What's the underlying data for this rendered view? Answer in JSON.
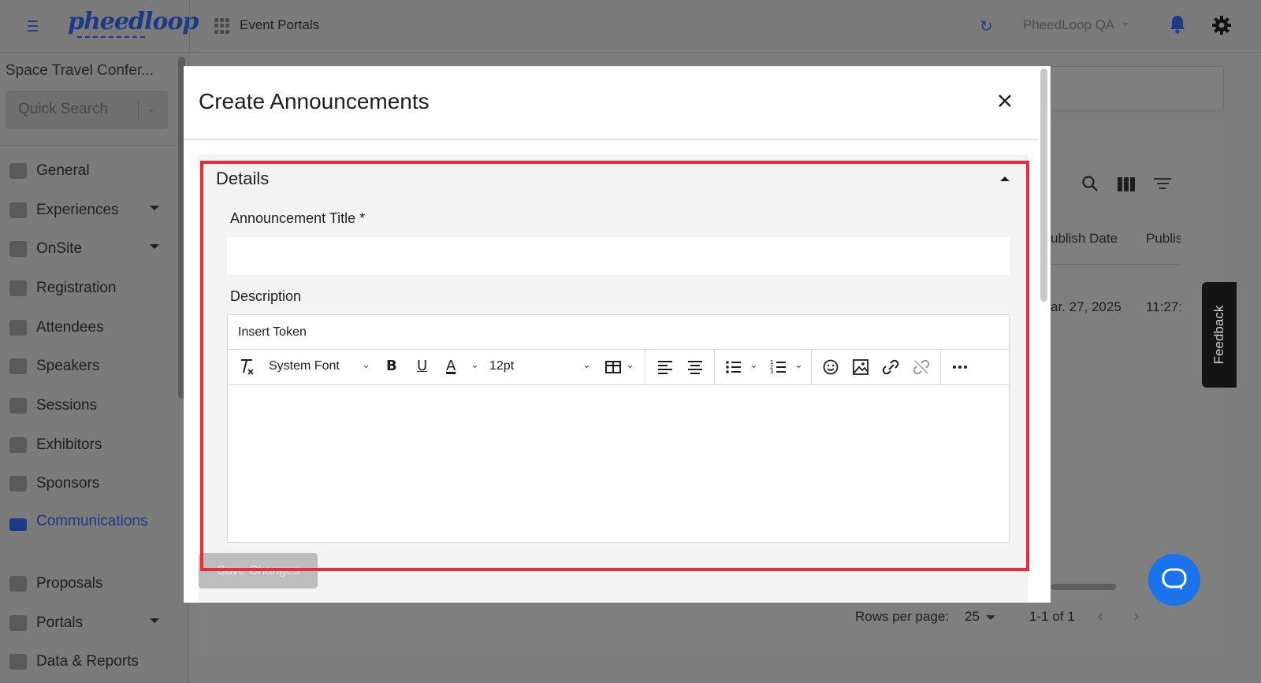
{
  "app": {
    "logo": "pheedloop",
    "section_title": "Event Portals",
    "organization": "PheedLoop QA"
  },
  "sidebar": {
    "event_name": "Space Travel Confer...",
    "quick_search_placeholder": "Quick Search",
    "items": [
      {
        "label": "General",
        "icon": "grid-icon",
        "expandable": false
      },
      {
        "label": "Experiences",
        "icon": "person-icon",
        "expandable": true
      },
      {
        "label": "OnSite",
        "icon": "printer-icon",
        "expandable": true
      },
      {
        "label": "Registration",
        "icon": "cart-icon",
        "expandable": false
      },
      {
        "label": "Attendees",
        "icon": "people-icon",
        "expandable": false
      },
      {
        "label": "Speakers",
        "icon": "speaker-icon",
        "expandable": false
      },
      {
        "label": "Sessions",
        "icon": "laptop-icon",
        "expandable": false
      },
      {
        "label": "Exhibitors",
        "icon": "store-icon",
        "expandable": false
      },
      {
        "label": "Sponsors",
        "icon": "badge-icon",
        "expandable": false
      },
      {
        "label": "Communications",
        "icon": "mail-icon",
        "expandable": false,
        "active": true
      },
      {
        "label": "Proposals",
        "icon": "document-icon",
        "expandable": false
      },
      {
        "label": "Portals",
        "icon": "globe-icon",
        "expandable": true
      },
      {
        "label": "Data & Reports",
        "icon": "chart-icon",
        "expandable": false
      }
    ]
  },
  "background_table": {
    "col_publish_date": "ublish Date",
    "col_publish_time": "Publis",
    "row_date": "ar. 27, 2025",
    "row_time": "11:27:3",
    "rows_per_page_label": "Rows per page:",
    "rows_per_page_value": "25",
    "range": "1-1 of 1"
  },
  "feedback_label": "Feedback",
  "modal": {
    "title": "Create Announcements",
    "section_title": "Details",
    "title_field_label": "Announcement Title *",
    "title_field_value": "",
    "description_label": "Description",
    "insert_token_label": "Insert Token",
    "font_family": "System Font",
    "font_size": "12pt",
    "save_label": "Save Changes"
  },
  "colors": {
    "brand": "#1b3b86",
    "highlight": "#ee2a37",
    "help_bubble": "#1a73e8"
  }
}
